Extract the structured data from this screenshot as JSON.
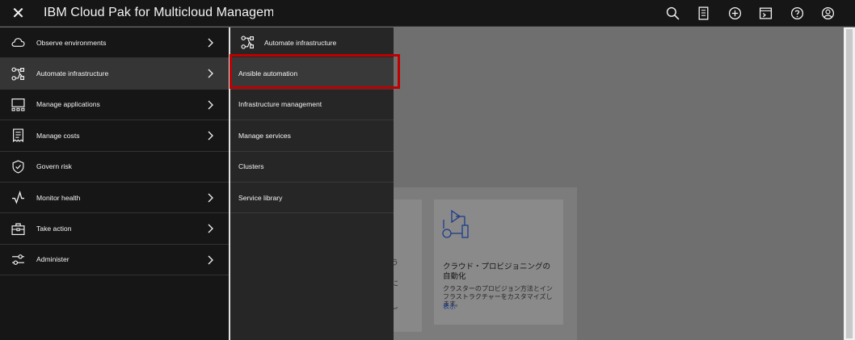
{
  "header": {
    "close_label": "✕",
    "title": "IBM Cloud Pak for Multicloud Managemer",
    "icons": [
      "search-icon",
      "catalog-icon",
      "add-icon",
      "terminal-icon",
      "help-icon",
      "user-icon"
    ]
  },
  "nav": {
    "items": [
      {
        "label": "Observe environments",
        "icon": "cloud-icon",
        "has_submenu": true
      },
      {
        "label": "Automate infrastructure",
        "icon": "flow-icon",
        "has_submenu": true
      },
      {
        "label": "Manage applications",
        "icon": "apps-icon",
        "has_submenu": true
      },
      {
        "label": "Manage costs",
        "icon": "receipt-icon",
        "has_submenu": true
      },
      {
        "label": "Govern risk",
        "icon": "shield-icon",
        "has_submenu": false
      },
      {
        "label": "Monitor health",
        "icon": "activity-icon",
        "has_submenu": true
      },
      {
        "label": "Take action",
        "icon": "toolbox-icon",
        "has_submenu": true
      },
      {
        "label": "Administer",
        "icon": "sliders-icon",
        "has_submenu": true
      }
    ]
  },
  "submenu": {
    "title": "Automate infrastructure",
    "items": [
      {
        "label": "Ansible automation"
      },
      {
        "label": "Infrastructure management"
      },
      {
        "label": "Manage services"
      },
      {
        "label": "Clusters"
      },
      {
        "label": "Service library"
      }
    ]
  },
  "background": {
    "card_title": "クラウド・プロビジョニングの自動化",
    "card_desc": "クラスターのプロビジョン方法とインフラストラクチャーをカスタマイズします。",
    "card_link": "表示",
    "frag1": "う",
    "frag2": "に",
    "frag3": "し"
  },
  "colors": {
    "header_bg": "#161616",
    "nav_bg": "#161616",
    "submenu_bg": "#262626",
    "highlight": "#c00000"
  }
}
